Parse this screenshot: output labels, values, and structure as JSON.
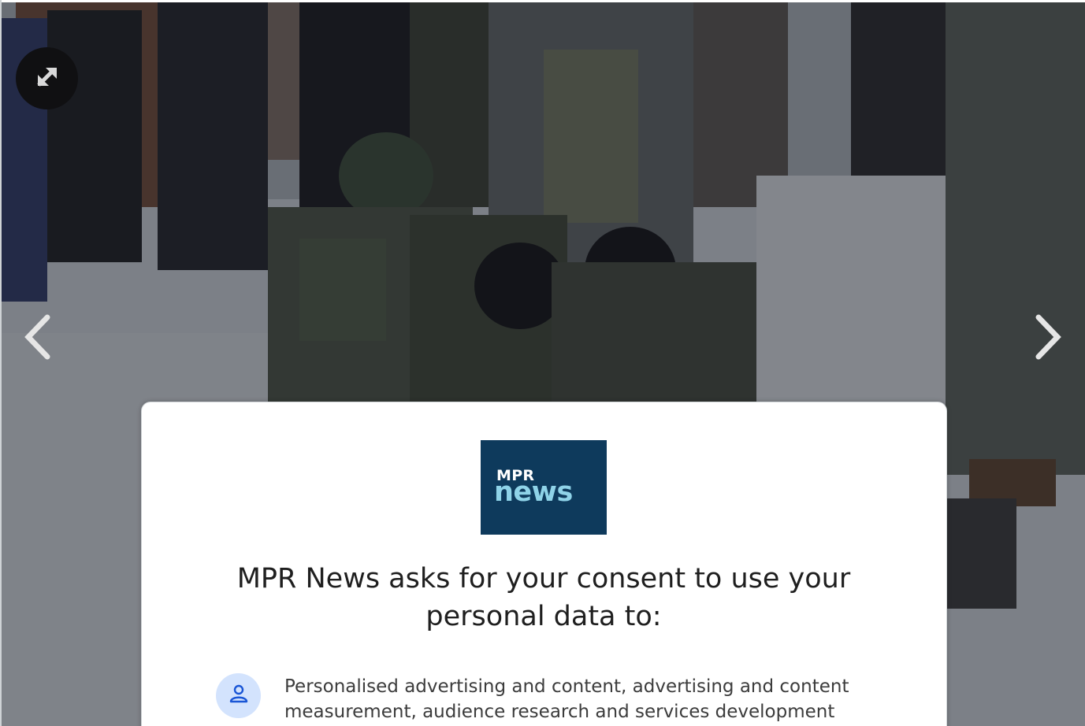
{
  "gallery": {
    "image_description_icon": "expand-arrows-icon",
    "prev_icon": "chevron-left-icon",
    "next_icon": "chevron-right-icon"
  },
  "consent_dialog": {
    "logo": {
      "line1": "MPR",
      "line2": "news",
      "background_color": "#0e3a5c",
      "accent_color": "#8fd3e8"
    },
    "title": "MPR News asks for your consent to use your personal data to:",
    "purposes": [
      {
        "icon": "person-icon",
        "text": "Personalised advertising and content, advertising and content measurement, audience research and services development"
      }
    ]
  }
}
